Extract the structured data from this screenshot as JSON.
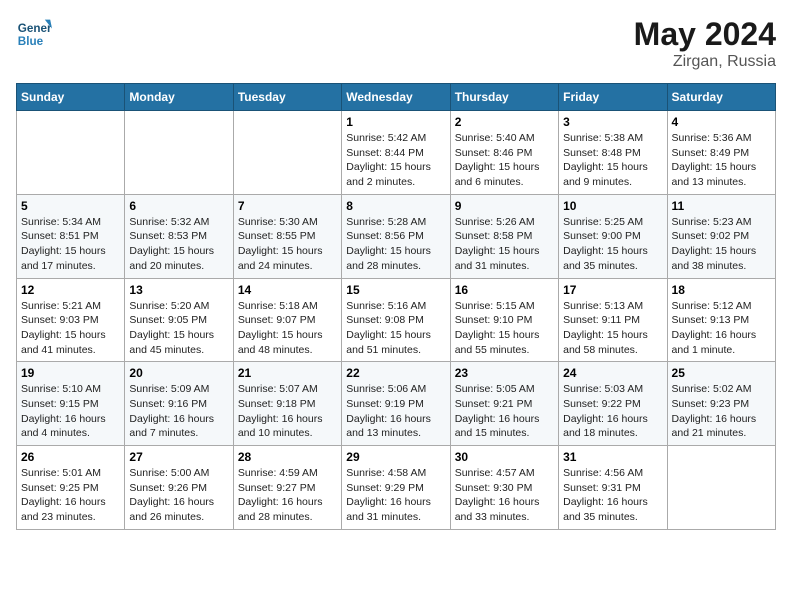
{
  "header": {
    "logo_line1": "General",
    "logo_line2": "Blue",
    "month_title": "May 2024",
    "location": "Zirgan, Russia"
  },
  "weekdays": [
    "Sunday",
    "Monday",
    "Tuesday",
    "Wednesday",
    "Thursday",
    "Friday",
    "Saturday"
  ],
  "weeks": [
    [
      {
        "day": "",
        "info": ""
      },
      {
        "day": "",
        "info": ""
      },
      {
        "day": "",
        "info": ""
      },
      {
        "day": "1",
        "info": "Sunrise: 5:42 AM\nSunset: 8:44 PM\nDaylight: 15 hours\nand 2 minutes."
      },
      {
        "day": "2",
        "info": "Sunrise: 5:40 AM\nSunset: 8:46 PM\nDaylight: 15 hours\nand 6 minutes."
      },
      {
        "day": "3",
        "info": "Sunrise: 5:38 AM\nSunset: 8:48 PM\nDaylight: 15 hours\nand 9 minutes."
      },
      {
        "day": "4",
        "info": "Sunrise: 5:36 AM\nSunset: 8:49 PM\nDaylight: 15 hours\nand 13 minutes."
      }
    ],
    [
      {
        "day": "5",
        "info": "Sunrise: 5:34 AM\nSunset: 8:51 PM\nDaylight: 15 hours\nand 17 minutes."
      },
      {
        "day": "6",
        "info": "Sunrise: 5:32 AM\nSunset: 8:53 PM\nDaylight: 15 hours\nand 20 minutes."
      },
      {
        "day": "7",
        "info": "Sunrise: 5:30 AM\nSunset: 8:55 PM\nDaylight: 15 hours\nand 24 minutes."
      },
      {
        "day": "8",
        "info": "Sunrise: 5:28 AM\nSunset: 8:56 PM\nDaylight: 15 hours\nand 28 minutes."
      },
      {
        "day": "9",
        "info": "Sunrise: 5:26 AM\nSunset: 8:58 PM\nDaylight: 15 hours\nand 31 minutes."
      },
      {
        "day": "10",
        "info": "Sunrise: 5:25 AM\nSunset: 9:00 PM\nDaylight: 15 hours\nand 35 minutes."
      },
      {
        "day": "11",
        "info": "Sunrise: 5:23 AM\nSunset: 9:02 PM\nDaylight: 15 hours\nand 38 minutes."
      }
    ],
    [
      {
        "day": "12",
        "info": "Sunrise: 5:21 AM\nSunset: 9:03 PM\nDaylight: 15 hours\nand 41 minutes."
      },
      {
        "day": "13",
        "info": "Sunrise: 5:20 AM\nSunset: 9:05 PM\nDaylight: 15 hours\nand 45 minutes."
      },
      {
        "day": "14",
        "info": "Sunrise: 5:18 AM\nSunset: 9:07 PM\nDaylight: 15 hours\nand 48 minutes."
      },
      {
        "day": "15",
        "info": "Sunrise: 5:16 AM\nSunset: 9:08 PM\nDaylight: 15 hours\nand 51 minutes."
      },
      {
        "day": "16",
        "info": "Sunrise: 5:15 AM\nSunset: 9:10 PM\nDaylight: 15 hours\nand 55 minutes."
      },
      {
        "day": "17",
        "info": "Sunrise: 5:13 AM\nSunset: 9:11 PM\nDaylight: 15 hours\nand 58 minutes."
      },
      {
        "day": "18",
        "info": "Sunrise: 5:12 AM\nSunset: 9:13 PM\nDaylight: 16 hours\nand 1 minute."
      }
    ],
    [
      {
        "day": "19",
        "info": "Sunrise: 5:10 AM\nSunset: 9:15 PM\nDaylight: 16 hours\nand 4 minutes."
      },
      {
        "day": "20",
        "info": "Sunrise: 5:09 AM\nSunset: 9:16 PM\nDaylight: 16 hours\nand 7 minutes."
      },
      {
        "day": "21",
        "info": "Sunrise: 5:07 AM\nSunset: 9:18 PM\nDaylight: 16 hours\nand 10 minutes."
      },
      {
        "day": "22",
        "info": "Sunrise: 5:06 AM\nSunset: 9:19 PM\nDaylight: 16 hours\nand 13 minutes."
      },
      {
        "day": "23",
        "info": "Sunrise: 5:05 AM\nSunset: 9:21 PM\nDaylight: 16 hours\nand 15 minutes."
      },
      {
        "day": "24",
        "info": "Sunrise: 5:03 AM\nSunset: 9:22 PM\nDaylight: 16 hours\nand 18 minutes."
      },
      {
        "day": "25",
        "info": "Sunrise: 5:02 AM\nSunset: 9:23 PM\nDaylight: 16 hours\nand 21 minutes."
      }
    ],
    [
      {
        "day": "26",
        "info": "Sunrise: 5:01 AM\nSunset: 9:25 PM\nDaylight: 16 hours\nand 23 minutes."
      },
      {
        "day": "27",
        "info": "Sunrise: 5:00 AM\nSunset: 9:26 PM\nDaylight: 16 hours\nand 26 minutes."
      },
      {
        "day": "28",
        "info": "Sunrise: 4:59 AM\nSunset: 9:27 PM\nDaylight: 16 hours\nand 28 minutes."
      },
      {
        "day": "29",
        "info": "Sunrise: 4:58 AM\nSunset: 9:29 PM\nDaylight: 16 hours\nand 31 minutes."
      },
      {
        "day": "30",
        "info": "Sunrise: 4:57 AM\nSunset: 9:30 PM\nDaylight: 16 hours\nand 33 minutes."
      },
      {
        "day": "31",
        "info": "Sunrise: 4:56 AM\nSunset: 9:31 PM\nDaylight: 16 hours\nand 35 minutes."
      },
      {
        "day": "",
        "info": ""
      }
    ]
  ]
}
